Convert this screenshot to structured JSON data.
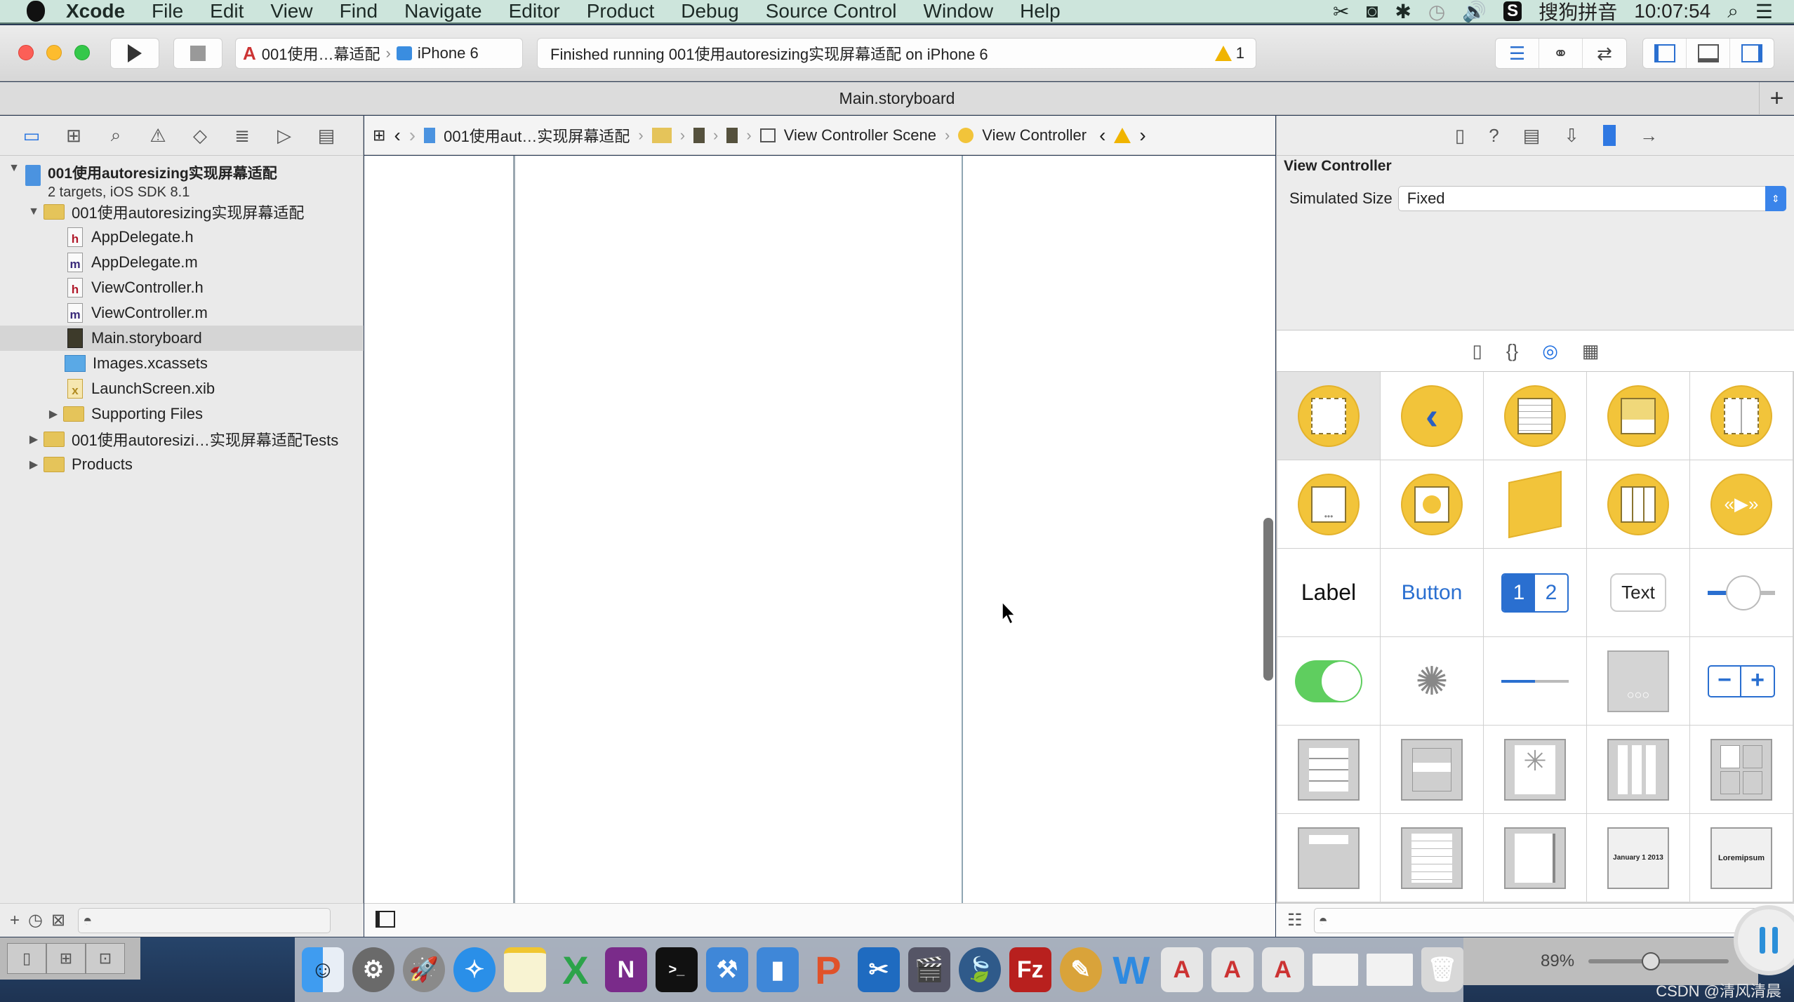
{
  "menubar": {
    "app": "Xcode",
    "items": [
      "File",
      "Edit",
      "View",
      "Find",
      "Navigate",
      "Editor",
      "Product",
      "Debug",
      "Source Control",
      "Window",
      "Help"
    ],
    "status": {
      "input_method": "搜狗拼音",
      "time": "10:07:54"
    }
  },
  "toolbar": {
    "scheme": "001使用…幕适配",
    "device": "iPhone 6",
    "activity_message": "Finished running 001使用autoresizing实现屏幕适配 on iPhone 6",
    "warning_count": "1"
  },
  "tabbar": {
    "title": "Main.storyboard",
    "add_label": "+"
  },
  "navigator": {
    "tabs": [
      "project-navigator",
      "symbol-navigator",
      "find-navigator",
      "issue-navigator",
      "test-navigator",
      "debug-navigator",
      "breakpoint-navigator",
      "report-navigator"
    ],
    "project": {
      "name": "001使用autoresizing实现屏幕适配",
      "subtitle": "2 targets, iOS SDK 8.1"
    },
    "items": [
      {
        "label": "001使用autoresizing实现屏幕适配",
        "type": "folder",
        "expanded": true
      },
      {
        "label": "AppDelegate.h",
        "type": "h"
      },
      {
        "label": "AppDelegate.m",
        "type": "m"
      },
      {
        "label": "ViewController.h",
        "type": "h"
      },
      {
        "label": "ViewController.m",
        "type": "m"
      },
      {
        "label": "Main.storyboard",
        "type": "storyboard",
        "selected": true
      },
      {
        "label": "Images.xcassets",
        "type": "xcassets"
      },
      {
        "label": "LaunchScreen.xib",
        "type": "xib"
      },
      {
        "label": "Supporting Files",
        "type": "folder",
        "expanded": false
      },
      {
        "label": "001使用autoresizi…实现屏幕适配Tests",
        "type": "folder",
        "expanded": false
      },
      {
        "label": "Products",
        "type": "folder",
        "expanded": false
      }
    ],
    "filter_placeholder": ""
  },
  "jumpbar": {
    "segments": [
      "001使用aut…实现屏幕适配",
      "View Controller Scene",
      "View Controller"
    ]
  },
  "inspector": {
    "section_title": "View Controller",
    "simulated_size_label": "Simulated Size",
    "simulated_size_value": "Fixed",
    "library_items": [
      "View Controller",
      "Navigation Controller",
      "Table View Controller",
      "Tab Bar Controller",
      "Split View Controller",
      "Page View Controller",
      "GLKit View Controller",
      "Object",
      "Collection View Controller",
      "AVKit Player View Controller",
      "Label",
      "Button",
      "Segmented Control",
      "Text Field",
      "Slider",
      "Switch",
      "Activity Indicator",
      "Progress View",
      "Page Control",
      "Stepper",
      "Table View",
      "Table View Cell",
      "Image View",
      "Collection View",
      "Collection View Cell",
      "Collection Reusable View",
      "Text View",
      "Scroll View",
      "Date Picker",
      "Picker View"
    ],
    "library_texts": {
      "label": "Label",
      "button": "Button",
      "seg1": "1",
      "seg2": "2",
      "text": "Text"
    }
  },
  "dock": {
    "zoom_percent": "89%",
    "apps": [
      "Finder",
      "System Preferences",
      "Launchpad",
      "Safari",
      "Notes",
      "Excel",
      "OneNote",
      "Terminal",
      "Xcode",
      "Simulator",
      "PowerPoint",
      "Snip",
      "Photo Booth",
      "FTP",
      "FileZilla",
      "Sketch",
      "Word",
      "Instruments",
      "Instruments"
    ]
  },
  "watermark": "CSDN @清风清晨"
}
